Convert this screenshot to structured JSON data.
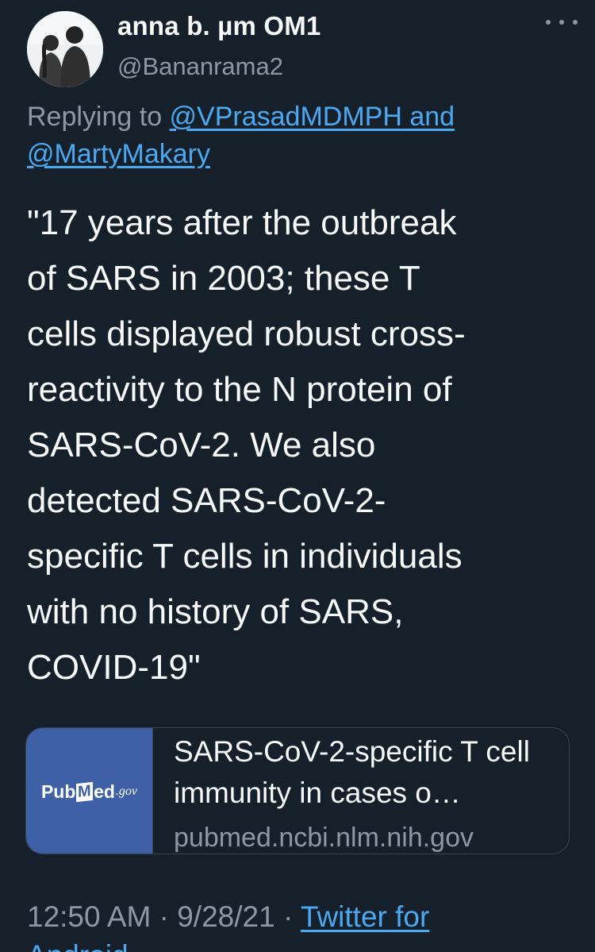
{
  "author": {
    "display_name": "anna b. µm OM1",
    "handle": "@Bananrama2",
    "avatar_icon": "profile-photo-couple"
  },
  "reply": {
    "prefix": "Replying to ",
    "mention_1": "@VPrasadMDMPH",
    "joiner": " and",
    "mention_2": "@MartyMakary"
  },
  "tweet": {
    "text": "\"17 years after the outbreak\nof SARS in 2003; these T\ncells displayed robust cross-\nreactivity to the N protein of\nSARS-CoV-2. We also\ndetected SARS-CoV-2-\nspecific T cells in individuals\nwith no history of SARS,\nCOVID-19\""
  },
  "link_card": {
    "thumb_logo_text": "PubMed.gov",
    "title": "SARS-CoV-2-specific T cell immunity in cases o…",
    "domain": "pubmed.ncbi.nlm.nih.gov"
  },
  "meta": {
    "time": "12:50 AM",
    "sep": " · ",
    "date": "9/28/21",
    "source": "Twitter for",
    "source_cont": "Android"
  },
  "colors": {
    "background": "#15202b",
    "text": "#f7f9f9",
    "secondary": "#8b98a5",
    "link": "#4aa9f0",
    "border": "#38444d",
    "pubmed_blue": "#3d60a6"
  }
}
